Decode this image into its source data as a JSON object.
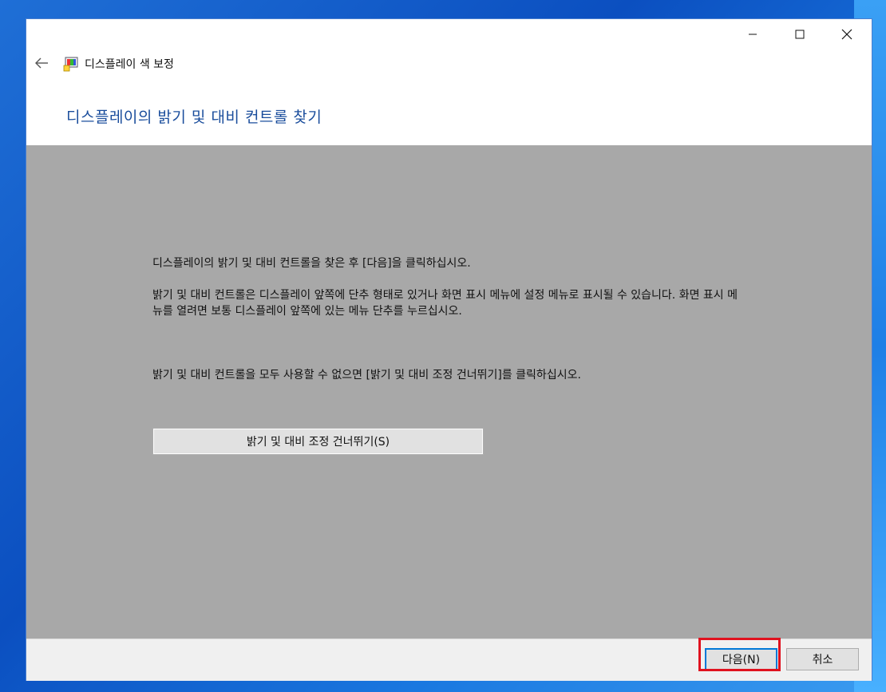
{
  "window": {
    "app_title": "디스플레이 색 보정",
    "controls": {
      "minimize_icon": "minimize-icon",
      "maximize_icon": "maximize-icon",
      "close_icon": "close-icon"
    }
  },
  "header": {
    "back_icon": "back-arrow-icon",
    "heading": "디스플레이의 밝기 및 대비 컨트롤 찾기"
  },
  "content": {
    "paragraph1": "디스플레이의 밝기 및 대비 컨트롤을 찾은 후 [다음]을 클릭하십시오.",
    "paragraph2": "밝기 및 대비 컨트롤은 디스플레이 앞쪽에 단추 형태로 있거나 화면 표시 메뉴에 설정 메뉴로 표시될 수 있습니다. 화면 표시 메뉴를 열려면 보통 디스플레이 앞쪽에 있는 메뉴 단추를 누르십시오.",
    "paragraph3": "밝기 및 대비 컨트롤을 모두 사용할 수 없으면 [밝기 및 대비 조정 건너뛰기]를 클릭하십시오.",
    "skip_button_label": "밝기 및 대비 조정 건너뛰기(S)"
  },
  "footer": {
    "next_label": "다음(N)",
    "cancel_label": "취소"
  },
  "colors": {
    "heading": "#1a4d9c",
    "content_bg": "#a8a8a8",
    "highlight": "#e0121f",
    "focus": "#0078d7"
  }
}
